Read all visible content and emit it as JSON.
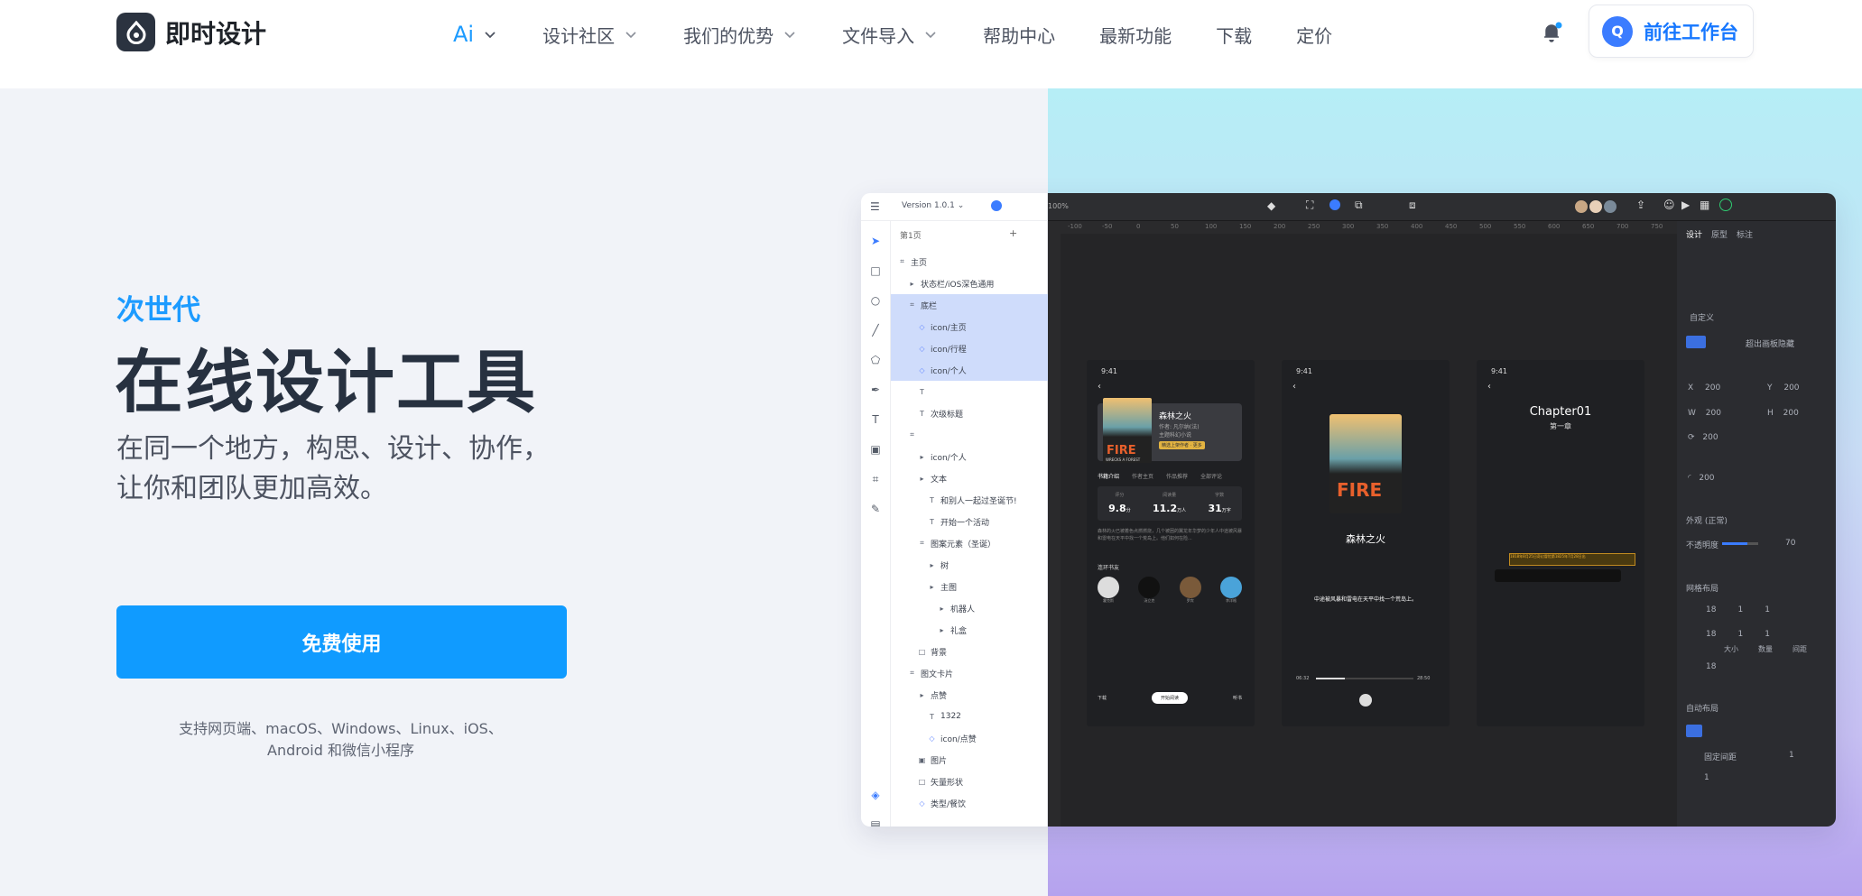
{
  "nav": {
    "logo_text": "即时设计",
    "items": [
      {
        "label": "Ai",
        "dropdown": true,
        "active": true
      },
      {
        "label": "设计社区",
        "dropdown": true
      },
      {
        "label": "我们的优势",
        "dropdown": true
      },
      {
        "label": "文件导入",
        "dropdown": true
      },
      {
        "label": "帮助中心",
        "dropdown": false
      },
      {
        "label": "最新功能",
        "dropdown": false
      },
      {
        "label": "下载",
        "dropdown": false
      },
      {
        "label": "定价",
        "dropdown": false
      }
    ],
    "cta_avatar": "Q",
    "cta_label": "前往工作台"
  },
  "hero": {
    "eyebrow": "次世代",
    "title": "在线设计工具",
    "subtitle_line1": "在同一个地方，构思、设计、协作，",
    "subtitle_line2": "让你和团队更加高效。",
    "button": "免费使用",
    "platforms_line1": "支持网页端、macOS、Windows、Linux、iOS、",
    "platforms_line2": "Android 和微信小程序"
  },
  "app": {
    "version": "Version 1.0.1",
    "zoom": "100%",
    "page": "第1页",
    "layers": [
      {
        "label": "主页",
        "icon": "frame",
        "indent": 0,
        "selected": false
      },
      {
        "label": "状态栏/iOS深色通用",
        "icon": "folder",
        "indent": 1,
        "selected": false
      },
      {
        "label": "底栏",
        "icon": "frame",
        "indent": 1,
        "selected": true
      },
      {
        "label": "icon/主页",
        "icon": "component",
        "indent": 2,
        "selected": true
      },
      {
        "label": "icon/行程",
        "icon": "component",
        "indent": 2,
        "selected": true
      },
      {
        "label": "icon/个人",
        "icon": "component",
        "indent": 2,
        "selected": true
      },
      {
        "label": "",
        "icon": "text",
        "indent": 2,
        "selected": false
      },
      {
        "label": "次级标题",
        "icon": "text",
        "indent": 2,
        "selected": false
      },
      {
        "label": "",
        "icon": "frame",
        "indent": 1,
        "selected": false
      },
      {
        "label": "icon/个人",
        "icon": "folder",
        "indent": 2,
        "selected": false
      },
      {
        "label": "文本",
        "icon": "folder",
        "indent": 2,
        "selected": false
      },
      {
        "label": "和别人一起过圣诞节!",
        "icon": "text",
        "indent": 3,
        "selected": false
      },
      {
        "label": "开始一个活动",
        "icon": "text",
        "indent": 3,
        "selected": false
      },
      {
        "label": "图案元素（圣诞）",
        "icon": "frame",
        "indent": 2,
        "selected": false
      },
      {
        "label": "树",
        "icon": "folder",
        "indent": 3,
        "selected": false
      },
      {
        "label": "主图",
        "icon": "folder",
        "indent": 3,
        "selected": false
      },
      {
        "label": "机器人",
        "icon": "folder",
        "indent": 4,
        "selected": false
      },
      {
        "label": "礼盒",
        "icon": "folder",
        "indent": 4,
        "selected": false
      },
      {
        "label": "背景",
        "icon": "rect",
        "indent": 2,
        "selected": false
      },
      {
        "label": "图文卡片",
        "icon": "frame",
        "indent": 1,
        "selected": false
      },
      {
        "label": "点赞",
        "icon": "folder",
        "indent": 2,
        "selected": false
      },
      {
        "label": "1322",
        "icon": "text",
        "indent": 3,
        "selected": false
      },
      {
        "label": "icon/点赞",
        "icon": "component",
        "indent": 3,
        "selected": false
      },
      {
        "label": "图片",
        "icon": "image",
        "indent": 2,
        "selected": false
      },
      {
        "label": "矢量形状",
        "icon": "rect",
        "indent": 2,
        "selected": false
      },
      {
        "label": "类型/餐饮",
        "icon": "component",
        "indent": 2,
        "selected": false
      }
    ],
    "ruler": [
      "-100",
      "-50",
      "0",
      "50",
      "100",
      "150",
      "200",
      "250",
      "300",
      "350",
      "400",
      "450",
      "500",
      "550",
      "600",
      "650",
      "700",
      "750"
    ],
    "right_tabs": [
      "设计",
      "原型",
      "标注"
    ],
    "props": {
      "frame_preset": "自定义",
      "clip_label": "超出画板隐藏",
      "x": "200",
      "y": "200",
      "w": "200",
      "h": "200",
      "rot": "200",
      "radius": "200",
      "appearance": "外观 (正常)",
      "opacity_label": "不透明度",
      "opacity": "70",
      "grid_title": "网格布局",
      "grid_rows": [
        [
          "18",
          "1",
          "1"
        ],
        [
          "18",
          "1",
          "1"
        ]
      ],
      "grid_labels": [
        "大小",
        "数量",
        "间距"
      ],
      "grid_third": "18",
      "auto_title": "自动布局",
      "gap_label": "固定间距",
      "gap": "1",
      "padding": "1"
    },
    "phones": [
      {
        "time": "9:41",
        "book_title": "森林之火",
        "book_meta1": "作者: 凡尔纳(法)",
        "book_meta2": "主题科幻小说",
        "badge": "精选上架作者 · 更多",
        "cover_text": "FIRE",
        "cover_sub": "WRECKS A FOREST",
        "tabs": [
          "书籍介绍",
          "作者主页",
          "作品推荐",
          "全部评论"
        ],
        "stats": [
          {
            "label": "评分",
            "value": "9.8",
            "unit": "分"
          },
          {
            "label": "阅读量",
            "value": "11.2",
            "unit": "万人"
          },
          {
            "label": "字数",
            "value": "31",
            "unit": "万字"
          }
        ],
        "desc": "森林的火已被着色点燃燃烧，几个被困的翼龙年华梦的少年人中途被风暴和雷电在天平中找一个荒岛上。他们如何在险...",
        "friends_title": "连环书友",
        "friends": [
          "霍克斯",
          "汤立克",
          "罗宾",
          "李洋格"
        ],
        "bottom": [
          "下载",
          "开始阅读",
          "听书"
        ]
      },
      {
        "time": "9:41",
        "title": "森林之火",
        "highlight": "中途被风暴和雷电在天平中找一个荒岛上。",
        "time_start": "06:32",
        "time_end": "28:50"
      },
      {
        "time": "9:41",
        "chapter": "Chapter01",
        "chapter_sub": "第一章",
        "highlight": "1818年8月25日奇幻冒险第1825年7月28日出"
      }
    ]
  }
}
